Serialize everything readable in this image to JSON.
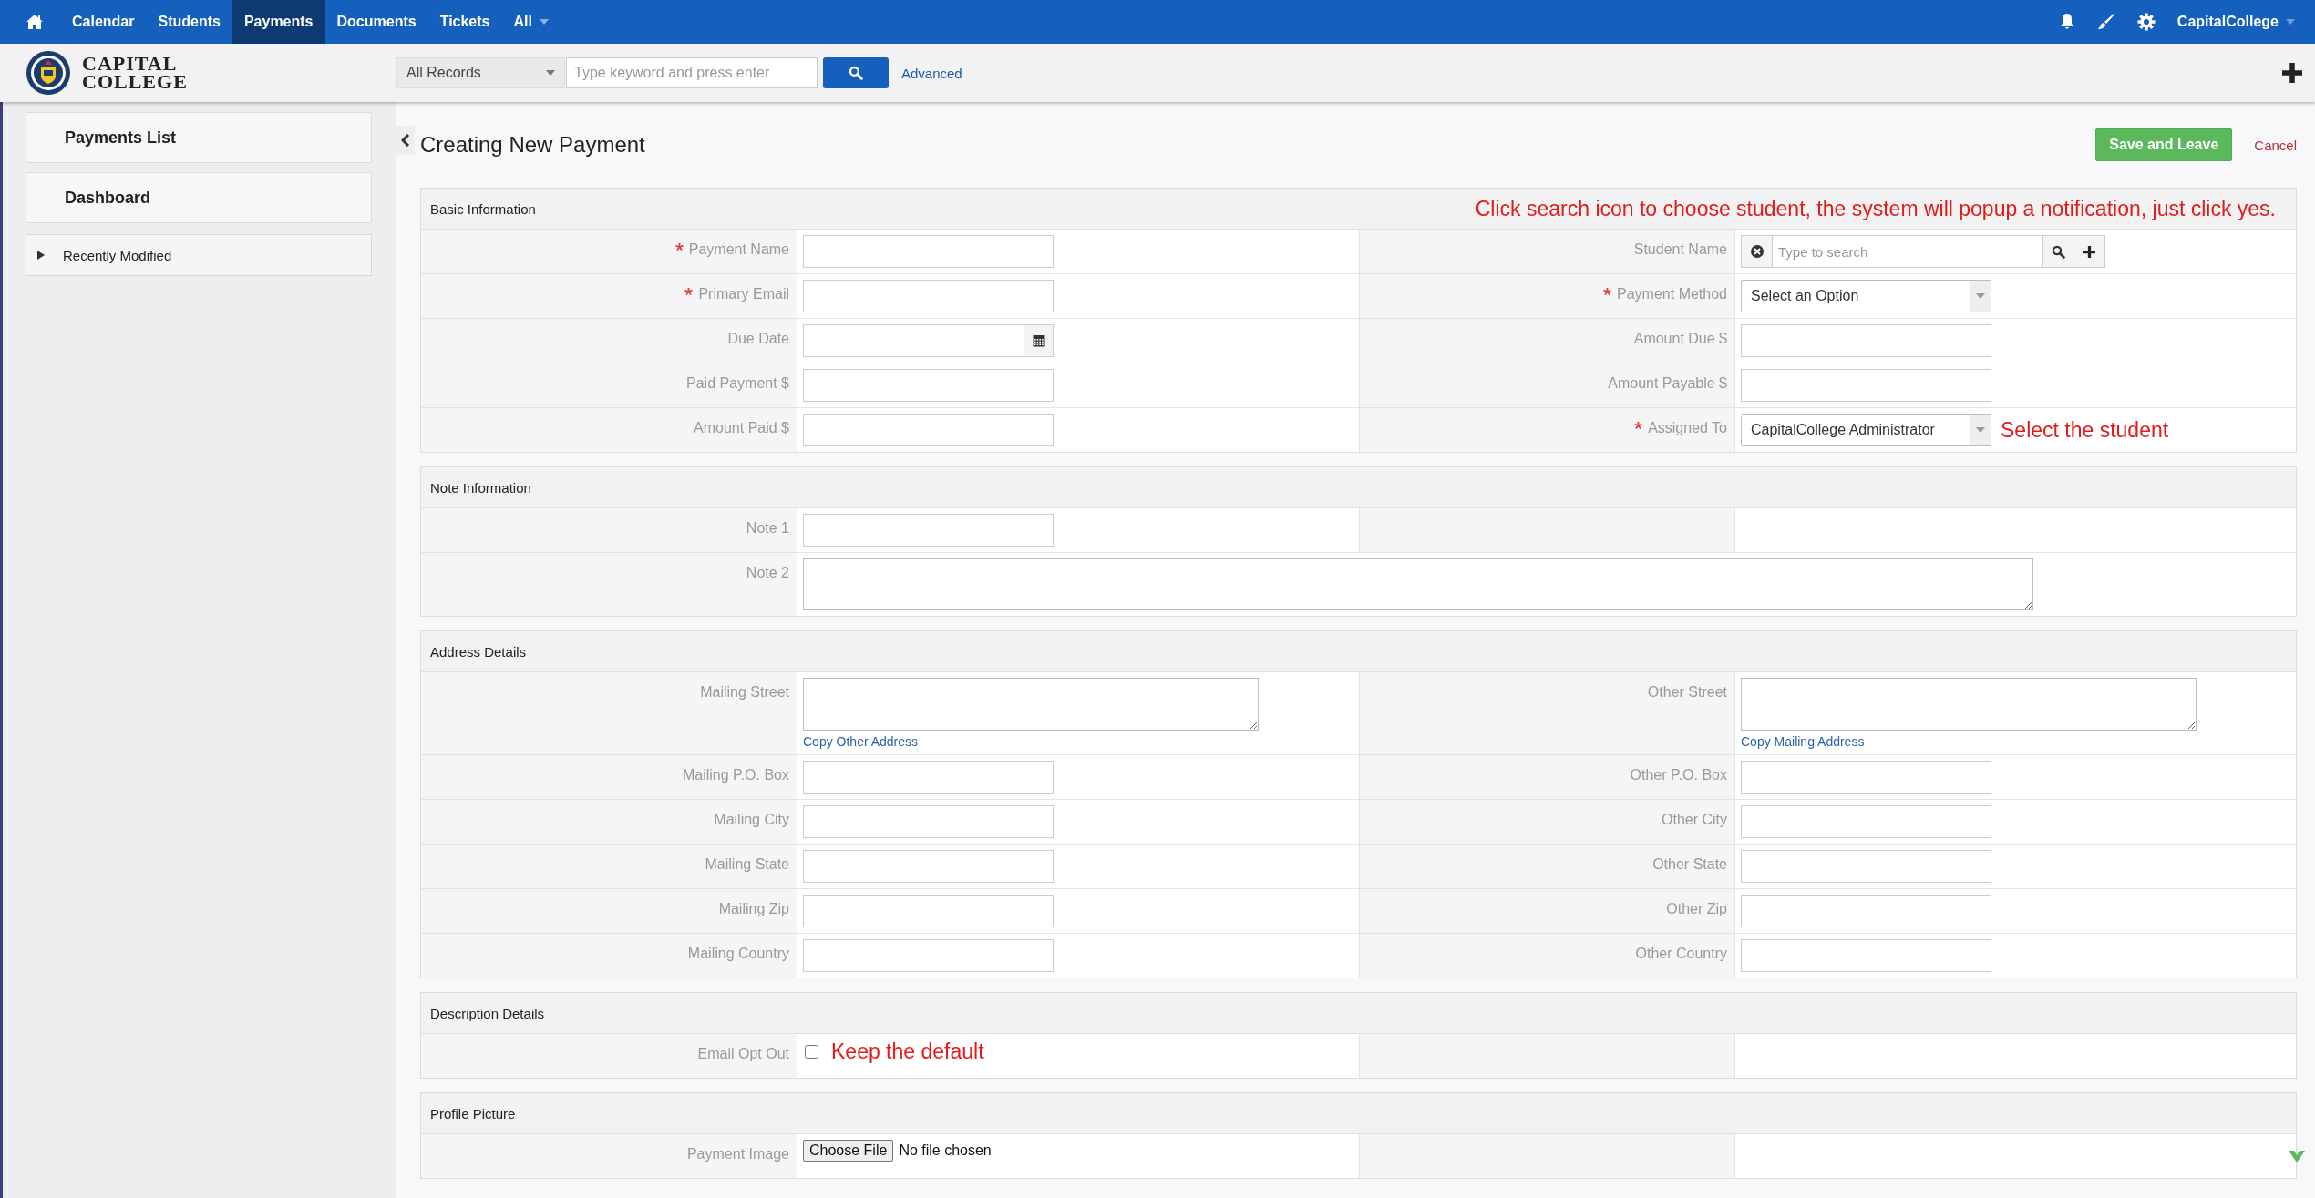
{
  "topnav": {
    "items": [
      {
        "label": "Calendar",
        "selected": false,
        "has_menu": false
      },
      {
        "label": "Students",
        "selected": false,
        "has_menu": false
      },
      {
        "label": "Payments",
        "selected": true,
        "has_menu": false
      },
      {
        "label": "Documents",
        "selected": false,
        "has_menu": false
      },
      {
        "label": "Tickets",
        "selected": false,
        "has_menu": false
      },
      {
        "label": "All",
        "selected": false,
        "has_menu": true
      }
    ],
    "user": "CapitalCollege"
  },
  "header": {
    "logo_lines": [
      "CAPITAL",
      "COLLEGE"
    ],
    "search_scope": "All Records",
    "search_placeholder": "Type keyword and press enter",
    "advanced_link": "Advanced"
  },
  "sidebar": {
    "items": [
      "Payments List",
      "Dashboard"
    ],
    "recent": {
      "label": "Recently Modified",
      "expanded": false
    }
  },
  "page": {
    "title": "Creating New Payment",
    "save_button": "Save and Leave",
    "cancel_link": "Cancel"
  },
  "sections": [
    {
      "title": "Basic Information",
      "note": "Click search icon to choose student, the system will popup a notification, just click yes.",
      "rows": [
        {
          "cells": [
            {
              "label": "Payment Name",
              "required": true,
              "field": {
                "kind": "text"
              }
            },
            {
              "label": "Student Name",
              "required": false,
              "field": {
                "kind": "lookup",
                "placeholder": "Type to search"
              }
            }
          ]
        },
        {
          "cells": [
            {
              "label": "Primary Email",
              "required": true,
              "field": {
                "kind": "text"
              }
            },
            {
              "label": "Payment Method",
              "required": true,
              "field": {
                "kind": "select",
                "value": "Select an Option"
              }
            }
          ]
        },
        {
          "cells": [
            {
              "label": "Due Date",
              "required": false,
              "field": {
                "kind": "date"
              }
            },
            {
              "label": "Amount Due $",
              "required": false,
              "field": {
                "kind": "text"
              }
            }
          ]
        },
        {
          "cells": [
            {
              "label": "Paid Payment $",
              "required": false,
              "field": {
                "kind": "text"
              }
            },
            {
              "label": "Amount Payable $",
              "required": false,
              "field": {
                "kind": "text"
              }
            }
          ]
        },
        {
          "cells": [
            {
              "label": "Amount Paid $",
              "required": false,
              "field": {
                "kind": "text"
              }
            },
            {
              "label": "Assigned To",
              "required": true,
              "field": {
                "kind": "select",
                "value": "CapitalCollege Administrator",
                "note": "Select the student"
              }
            }
          ]
        }
      ]
    },
    {
      "title": "Note Information",
      "rows": [
        {
          "cells": [
            {
              "label": "Note 1",
              "required": false,
              "field": {
                "kind": "text"
              }
            },
            {}
          ]
        },
        {
          "cells": [
            {
              "label": "Note 2",
              "required": false,
              "field": {
                "kind": "wide-textarea"
              }
            }
          ]
        }
      ]
    },
    {
      "title": "Address Details",
      "rows": [
        {
          "cells": [
            {
              "label": "Mailing Street",
              "required": false,
              "field": {
                "kind": "textarea",
                "link": "Copy Other Address"
              }
            },
            {
              "label": "Other Street",
              "required": false,
              "field": {
                "kind": "textarea",
                "link": "Copy Mailing Address"
              }
            }
          ]
        },
        {
          "cells": [
            {
              "label": "Mailing P.O. Box",
              "required": false,
              "field": {
                "kind": "text"
              }
            },
            {
              "label": "Other P.O. Box",
              "required": false,
              "field": {
                "kind": "text"
              }
            }
          ]
        },
        {
          "cells": [
            {
              "label": "Mailing City",
              "required": false,
              "field": {
                "kind": "text"
              }
            },
            {
              "label": "Other City",
              "required": false,
              "field": {
                "kind": "text"
              }
            }
          ]
        },
        {
          "cells": [
            {
              "label": "Mailing State",
              "required": false,
              "field": {
                "kind": "text"
              }
            },
            {
              "label": "Other State",
              "required": false,
              "field": {
                "kind": "text"
              }
            }
          ]
        },
        {
          "cells": [
            {
              "label": "Mailing Zip",
              "required": false,
              "field": {
                "kind": "text"
              }
            },
            {
              "label": "Other Zip",
              "required": false,
              "field": {
                "kind": "text"
              }
            }
          ]
        },
        {
          "cells": [
            {
              "label": "Mailing Country",
              "required": false,
              "field": {
                "kind": "text"
              }
            },
            {
              "label": "Other Country",
              "required": false,
              "field": {
                "kind": "text"
              }
            }
          ]
        }
      ]
    },
    {
      "title": "Description Details",
      "rows": [
        {
          "cells": [
            {
              "label": "Email Opt Out",
              "required": false,
              "field": {
                "kind": "checkbox",
                "checked": false,
                "note": "Keep the default"
              }
            },
            {}
          ]
        }
      ]
    },
    {
      "title": "Profile Picture",
      "rows": [
        {
          "cells": [
            {
              "label": "Payment Image",
              "required": false,
              "field": {
                "kind": "file",
                "button": "Choose File",
                "status": "No file chosen"
              }
            },
            {}
          ]
        }
      ]
    }
  ]
}
